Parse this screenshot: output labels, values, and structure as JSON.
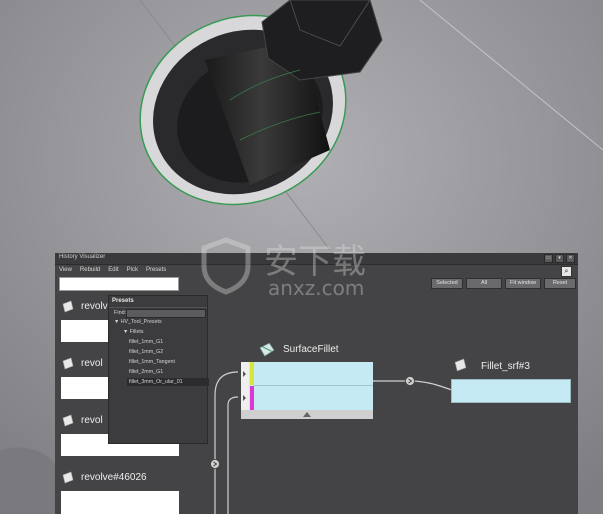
{
  "window": {
    "title": "History Visualizer",
    "controls": [
      "▭",
      "▾",
      "✕"
    ]
  },
  "menubar": [
    "View",
    "Rebuild",
    "Edit",
    "Pick",
    "Presets"
  ],
  "toolbar": {
    "buttons": [
      "Selected",
      "All",
      "Fit window",
      "Reset"
    ]
  },
  "left_nodes": [
    {
      "label": "revolve"
    },
    {
      "label": "revol"
    },
    {
      "label": "revol"
    },
    {
      "label": "revolve#46026"
    }
  ],
  "presets_panel": {
    "title": "Presets",
    "find_label": "Find:",
    "tree": [
      {
        "label": "▼  HV_Tool_Presets",
        "level": 0
      },
      {
        "label": "▼  Fillets",
        "level": 1
      },
      {
        "label": "fillet_1mm_G1",
        "level": 2
      },
      {
        "label": "fillet_1mm_G2",
        "level": 2
      },
      {
        "label": "fillet_1mm_Tangent",
        "level": 2
      },
      {
        "label": "fillet_2mm_G1",
        "level": 2
      },
      {
        "label": "fillet_3mm_Or_ular_01",
        "level": 2,
        "selected": true
      }
    ]
  },
  "surface_fillet_node": {
    "label": "SurfaceFillet"
  },
  "fillet_node": {
    "label": "Fillet_srf#3"
  },
  "icons": {
    "node_icon": "surface-sheet-icon",
    "magnify": "magnify-icon"
  },
  "watermark": {
    "text_cn": "安下载",
    "text_en": "anxz.com"
  }
}
